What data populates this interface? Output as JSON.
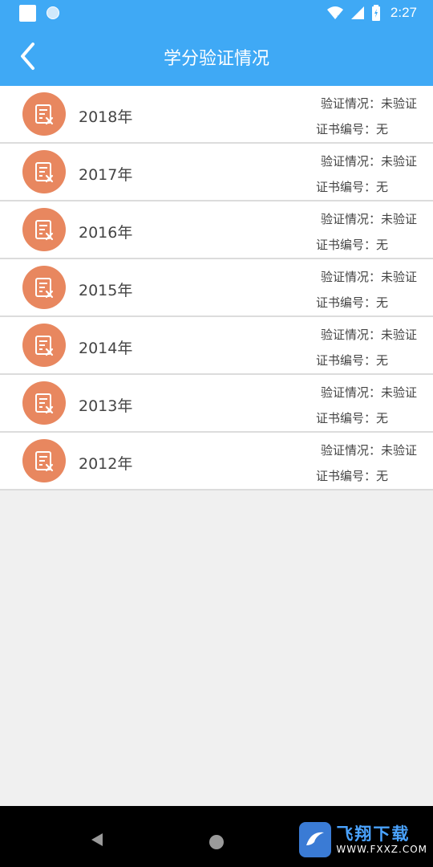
{
  "status_bar": {
    "time": "2:27"
  },
  "header": {
    "title": "学分验证情况"
  },
  "rows": [
    {
      "year": "2018年",
      "status": "验证情况：未验证",
      "cert": "证书编号：无"
    },
    {
      "year": "2017年",
      "status": "验证情况：未验证",
      "cert": "证书编号：无"
    },
    {
      "year": "2016年",
      "status": "验证情况：未验证",
      "cert": "证书编号：无"
    },
    {
      "year": "2015年",
      "status": "验证情况：未验证",
      "cert": "证书编号：无"
    },
    {
      "year": "2014年",
      "status": "验证情况：未验证",
      "cert": "证书编号：无"
    },
    {
      "year": "2013年",
      "status": "验证情况：未验证",
      "cert": "证书编号：无"
    },
    {
      "year": "2012年",
      "status": "验证情况：未验证",
      "cert": "证书编号：无"
    }
  ],
  "colors": {
    "accent": "#3fa9f5",
    "icon_bg": "#e8875f",
    "page_bg": "#f0f0f0"
  },
  "icons": {
    "back": "chevron-left-icon",
    "row": "document-cross-icon"
  },
  "watermark": {
    "main": "飞翔下载",
    "sub": "WWW.FXXZ.COM"
  }
}
